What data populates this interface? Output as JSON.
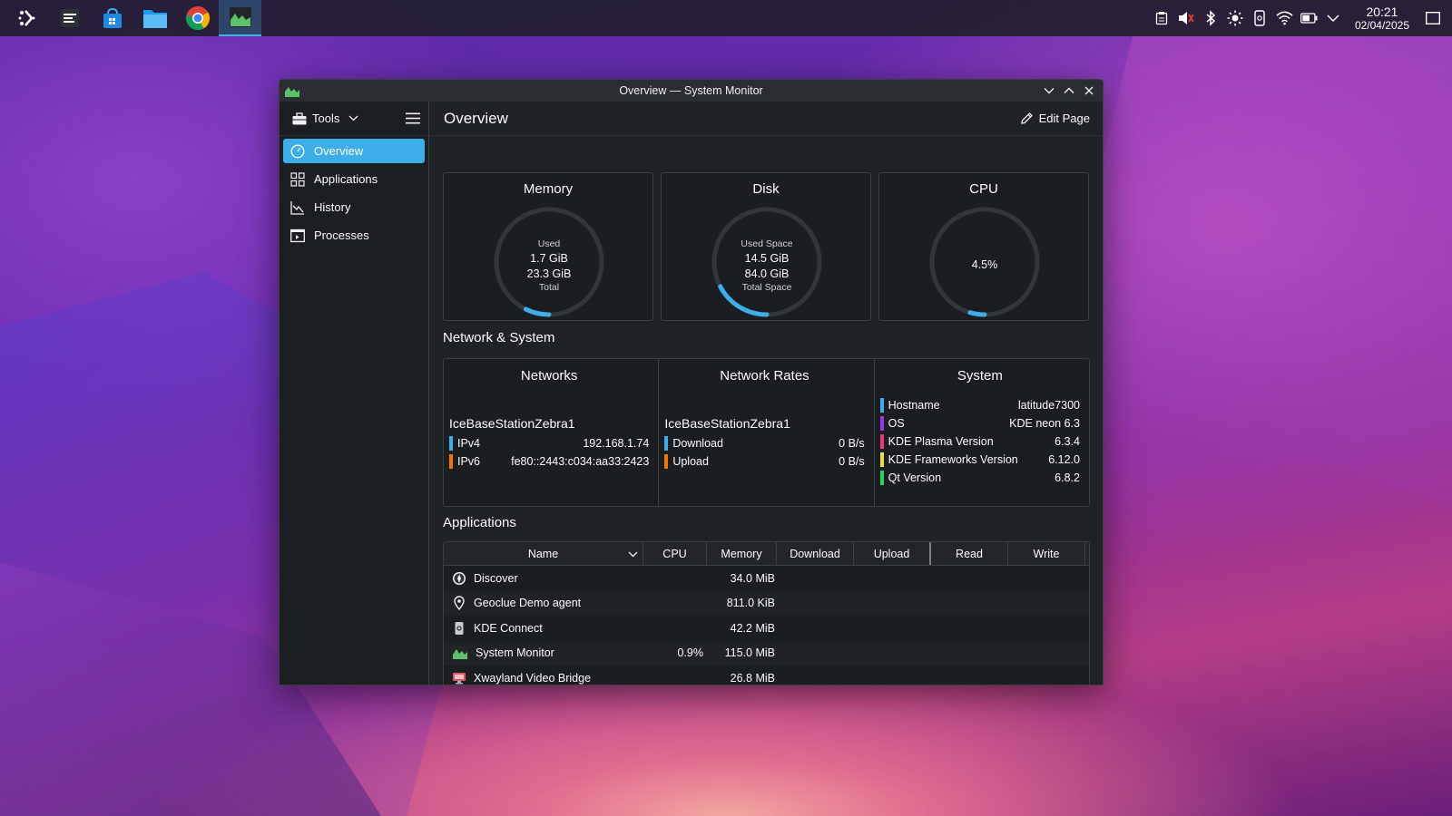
{
  "taskbar": {
    "apps": [
      {
        "name": "app-launcher"
      },
      {
        "name": "system-settings"
      },
      {
        "name": "discover-store"
      },
      {
        "name": "file-manager"
      },
      {
        "name": "chrome-browser"
      },
      {
        "name": "system-monitor",
        "active": true
      }
    ],
    "clock": {
      "time": "20:21",
      "date": "02/04/2025"
    }
  },
  "window": {
    "title": "Overview — System Monitor"
  },
  "sidebar": {
    "tools_label": "Tools",
    "items": [
      {
        "label": "Overview",
        "active": true
      },
      {
        "label": "Applications"
      },
      {
        "label": "History"
      },
      {
        "label": "Processes"
      }
    ]
  },
  "main": {
    "page_title": "Overview",
    "edit_page_label": "Edit Page"
  },
  "cards": {
    "memory": {
      "title": "Memory",
      "top_label": "Used",
      "used": "1.7 GiB",
      "total": "23.3 GiB",
      "bottom_label": "Total",
      "fraction": 0.073
    },
    "disk": {
      "title": "Disk",
      "top_label": "Used Space",
      "used": "14.5 GiB",
      "total": "84.0 GiB",
      "bottom_label": "Total Space",
      "fraction": 0.173
    },
    "cpu": {
      "title": "CPU",
      "value": "4.5%",
      "fraction": 0.045
    }
  },
  "network_system": {
    "section_title": "Network & System",
    "networks": {
      "title": "Networks",
      "interface": "IceBaseStationZebra1",
      "rows": [
        {
          "label": "IPv4",
          "value": "192.168.1.74",
          "color": "#3daee9"
        },
        {
          "label": "IPv6",
          "value": "fe80::2443:c034:aa33:2423",
          "color": "#f67400"
        }
      ]
    },
    "rates": {
      "title": "Network Rates",
      "interface": "IceBaseStationZebra1",
      "rows": [
        {
          "label": "Download",
          "value": "0 B/s",
          "color": "#3daee9"
        },
        {
          "label": "Upload",
          "value": "0 B/s",
          "color": "#f67400"
        }
      ]
    },
    "system": {
      "title": "System",
      "rows": [
        {
          "label": "Hostname",
          "value": "latitude7300",
          "color": "#3daee9"
        },
        {
          "label": "OS",
          "value": "KDE neon 6.3",
          "color": "#9b37e8"
        },
        {
          "label": "KDE Plasma Version",
          "value": "6.3.4",
          "color": "#e93a7d"
        },
        {
          "label": "KDE Frameworks Version",
          "value": "6.12.0",
          "color": "#e8e047"
        },
        {
          "label": "Qt Version",
          "value": "6.8.2",
          "color": "#27d65c"
        }
      ]
    }
  },
  "applications": {
    "section_title": "Applications",
    "columns": [
      "Name",
      "CPU",
      "Memory",
      "Download",
      "Upload",
      "Read",
      "Write"
    ],
    "rows": [
      {
        "name": "Discover",
        "cpu": "",
        "memory": "34.0 MiB"
      },
      {
        "name": "Geoclue Demo agent",
        "cpu": "",
        "memory": "811.0 KiB"
      },
      {
        "name": "KDE Connect",
        "cpu": "",
        "memory": "42.2 MiB"
      },
      {
        "name": "System Monitor",
        "cpu": "0.9%",
        "memory": "115.0 MiB"
      },
      {
        "name": "Xwayland Video Bridge",
        "cpu": "",
        "memory": "26.8 MiB"
      }
    ]
  },
  "colors": {
    "accent": "#3daee9",
    "gauge_track": "#31363b"
  }
}
